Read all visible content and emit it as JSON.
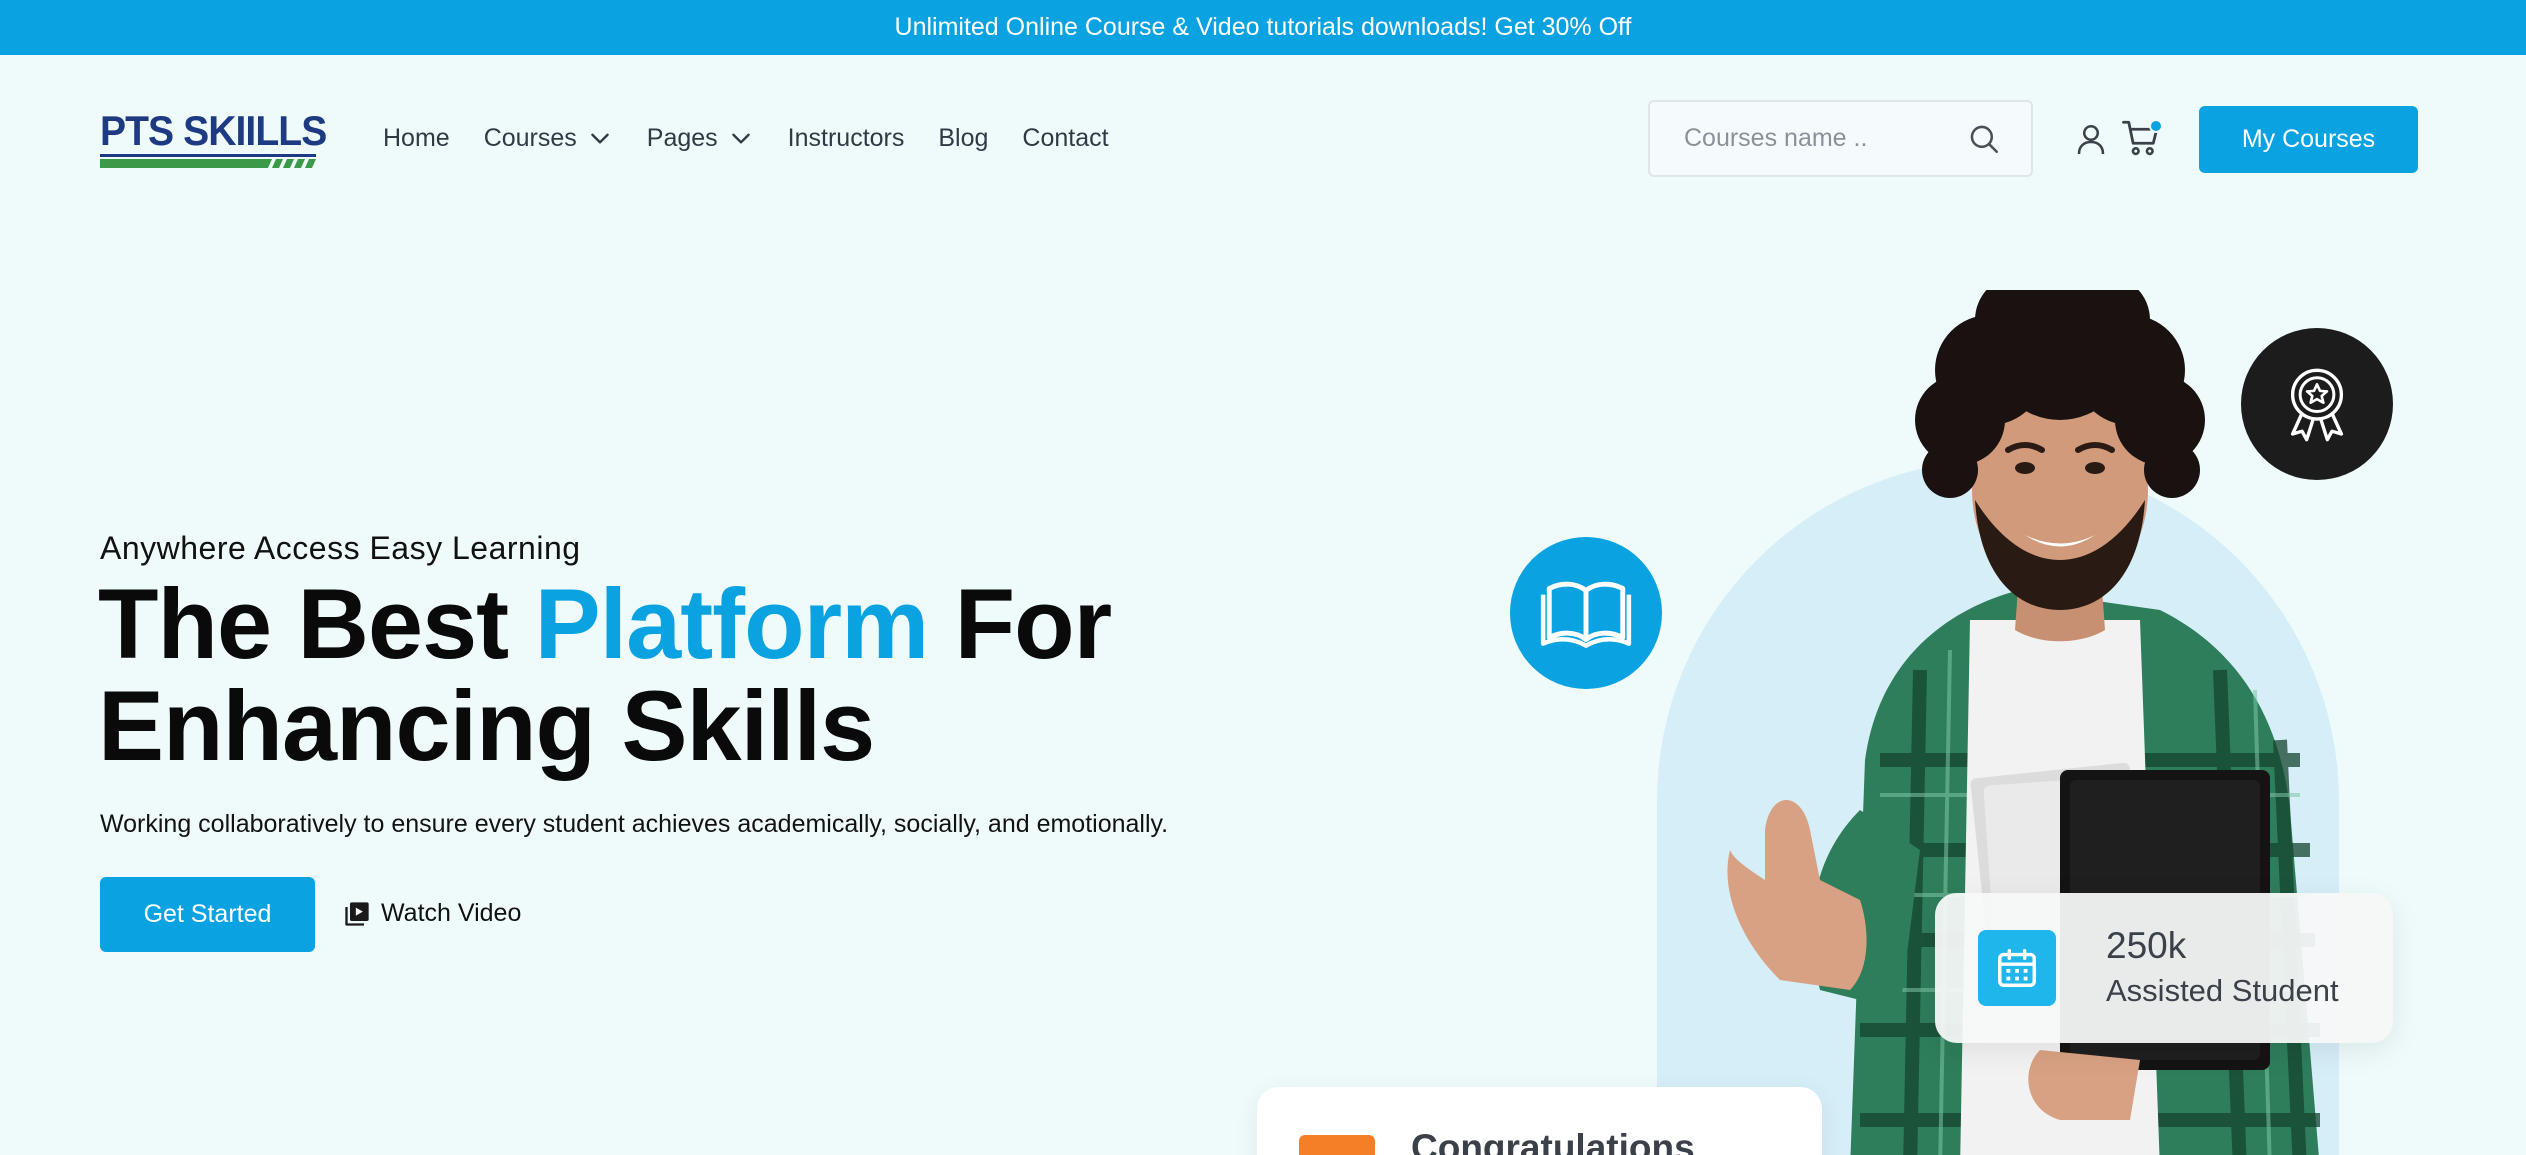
{
  "promo_bar": {
    "text": "Unlimited Online Course & Video tutorials downloads! Get 30% Off"
  },
  "logo": {
    "text": "PTS SKIILLS"
  },
  "nav": {
    "items": [
      {
        "label": "Home"
      },
      {
        "label": "Courses",
        "has_dropdown": true
      },
      {
        "label": "Pages",
        "has_dropdown": true
      },
      {
        "label": "Instructors"
      },
      {
        "label": "Blog"
      },
      {
        "label": "Contact"
      }
    ]
  },
  "search": {
    "placeholder": "Courses name ..",
    "icon": "search-icon"
  },
  "header_actions": {
    "user_icon": "user-icon",
    "cart_icon": "cart-icon",
    "my_courses_label": "My Courses"
  },
  "hero": {
    "eyebrow": "Anywhere Access Easy Learning",
    "headline_part1": "The Best ",
    "headline_accent": "Platform",
    "headline_part2": " For",
    "headline_line2": "Enhancing Skills",
    "subtitle": "Working collaboratively to ensure every student achieves academically, socially, and emotionally.",
    "cta_primary": "Get Started",
    "cta_secondary": "Watch Video"
  },
  "stats_card": {
    "number": "250k",
    "label": "Assisted Student",
    "icon": "calendar-icon"
  },
  "congrats_card": {
    "title": "Congratulations"
  },
  "colors": {
    "accent": "#0aa2e0",
    "background": "#effbfb",
    "logo_blue": "#1d3a82",
    "logo_green": "#3b9a47",
    "orange": "#f47f27"
  }
}
